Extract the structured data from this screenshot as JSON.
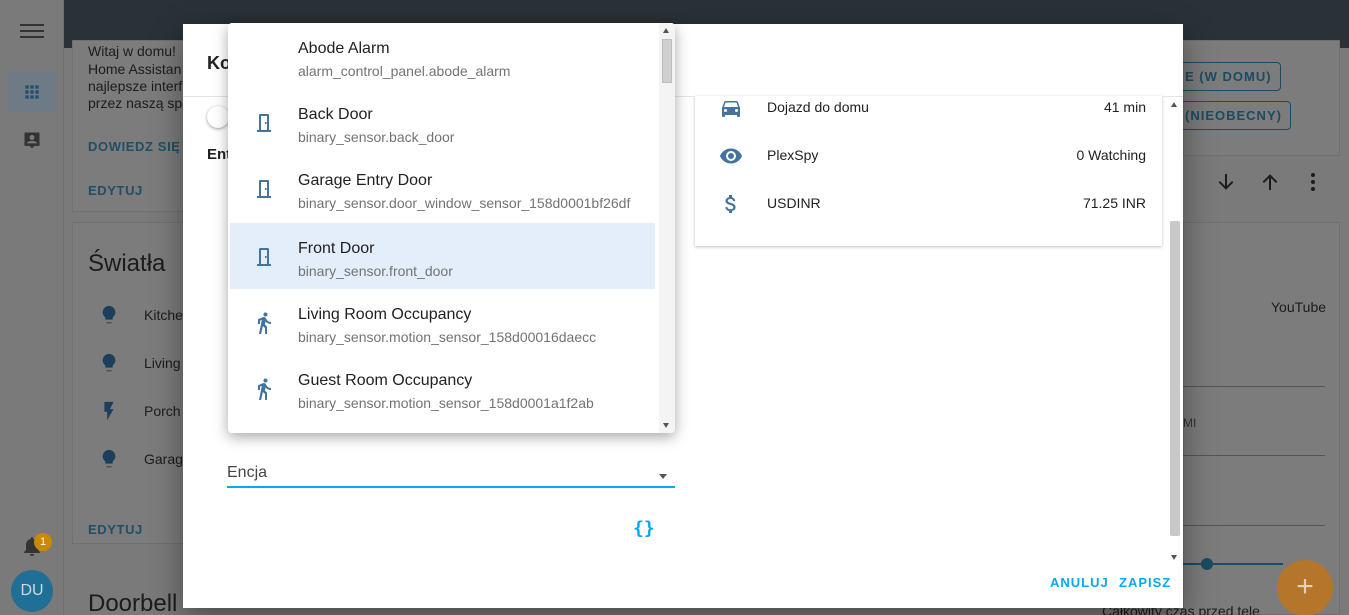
{
  "background": {
    "intro_lines": [
      "Witaj w domu!",
      "Home Assistan",
      "najlepsze interf",
      "przez naszą spo"
    ],
    "learn_more": "DOWIEDZ SIĘ W",
    "edit_label": "EDYTUJ",
    "lights_title": "Światła",
    "lights": [
      "Kitche",
      "Living",
      "Porch",
      "Garag"
    ],
    "doorbell_title": "Doorbell",
    "home_button": "E (W DOMU)",
    "away_button": "(NIEOBECNY)",
    "youtube_label": "YouTube",
    "mi_label": "MI",
    "total_time_label": "Całkowity czas przed tele",
    "notification_count": "1",
    "avatar_initials": "DU",
    "fab_label": "+"
  },
  "dialog": {
    "title": "Ko",
    "entities_label": "Ent",
    "preview_rows": [
      {
        "name": "Dojazd do domu",
        "value": "41 min",
        "icon": "car-icon"
      },
      {
        "name": "PlexSpy",
        "value": "0 Watching",
        "icon": "eye-icon"
      },
      {
        "name": "USDINR",
        "value": "71.25 INR",
        "icon": "dollar-icon"
      }
    ],
    "entity_field_label": "Encja",
    "code_editor_icon": "{}",
    "cancel_label": "ANULUJ",
    "save_label": "ZAPISZ"
  },
  "dropdown": {
    "items": [
      {
        "title": "Abode Alarm",
        "sub": "alarm_control_panel.abode_alarm",
        "icon": "none"
      },
      {
        "title": "Back Door",
        "sub": "binary_sensor.back_door",
        "icon": "door-icon"
      },
      {
        "title": "Garage Entry Door",
        "sub": "binary_sensor.door_window_sensor_158d0001bf26df",
        "icon": "door-icon"
      },
      {
        "title": "Front Door",
        "sub": "binary_sensor.front_door",
        "icon": "door-icon",
        "selected": true
      },
      {
        "title": "Living Room Occupancy",
        "sub": "binary_sensor.motion_sensor_158d00016daecc",
        "icon": "walking-icon"
      },
      {
        "title": "Guest Room Occupancy",
        "sub": "binary_sensor.motion_sensor_158d0001a1f2ab",
        "icon": "walking-icon"
      }
    ]
  },
  "colors": {
    "accent": "#03a9f4",
    "icon": "#44739e",
    "selected": "#e3eefa"
  }
}
